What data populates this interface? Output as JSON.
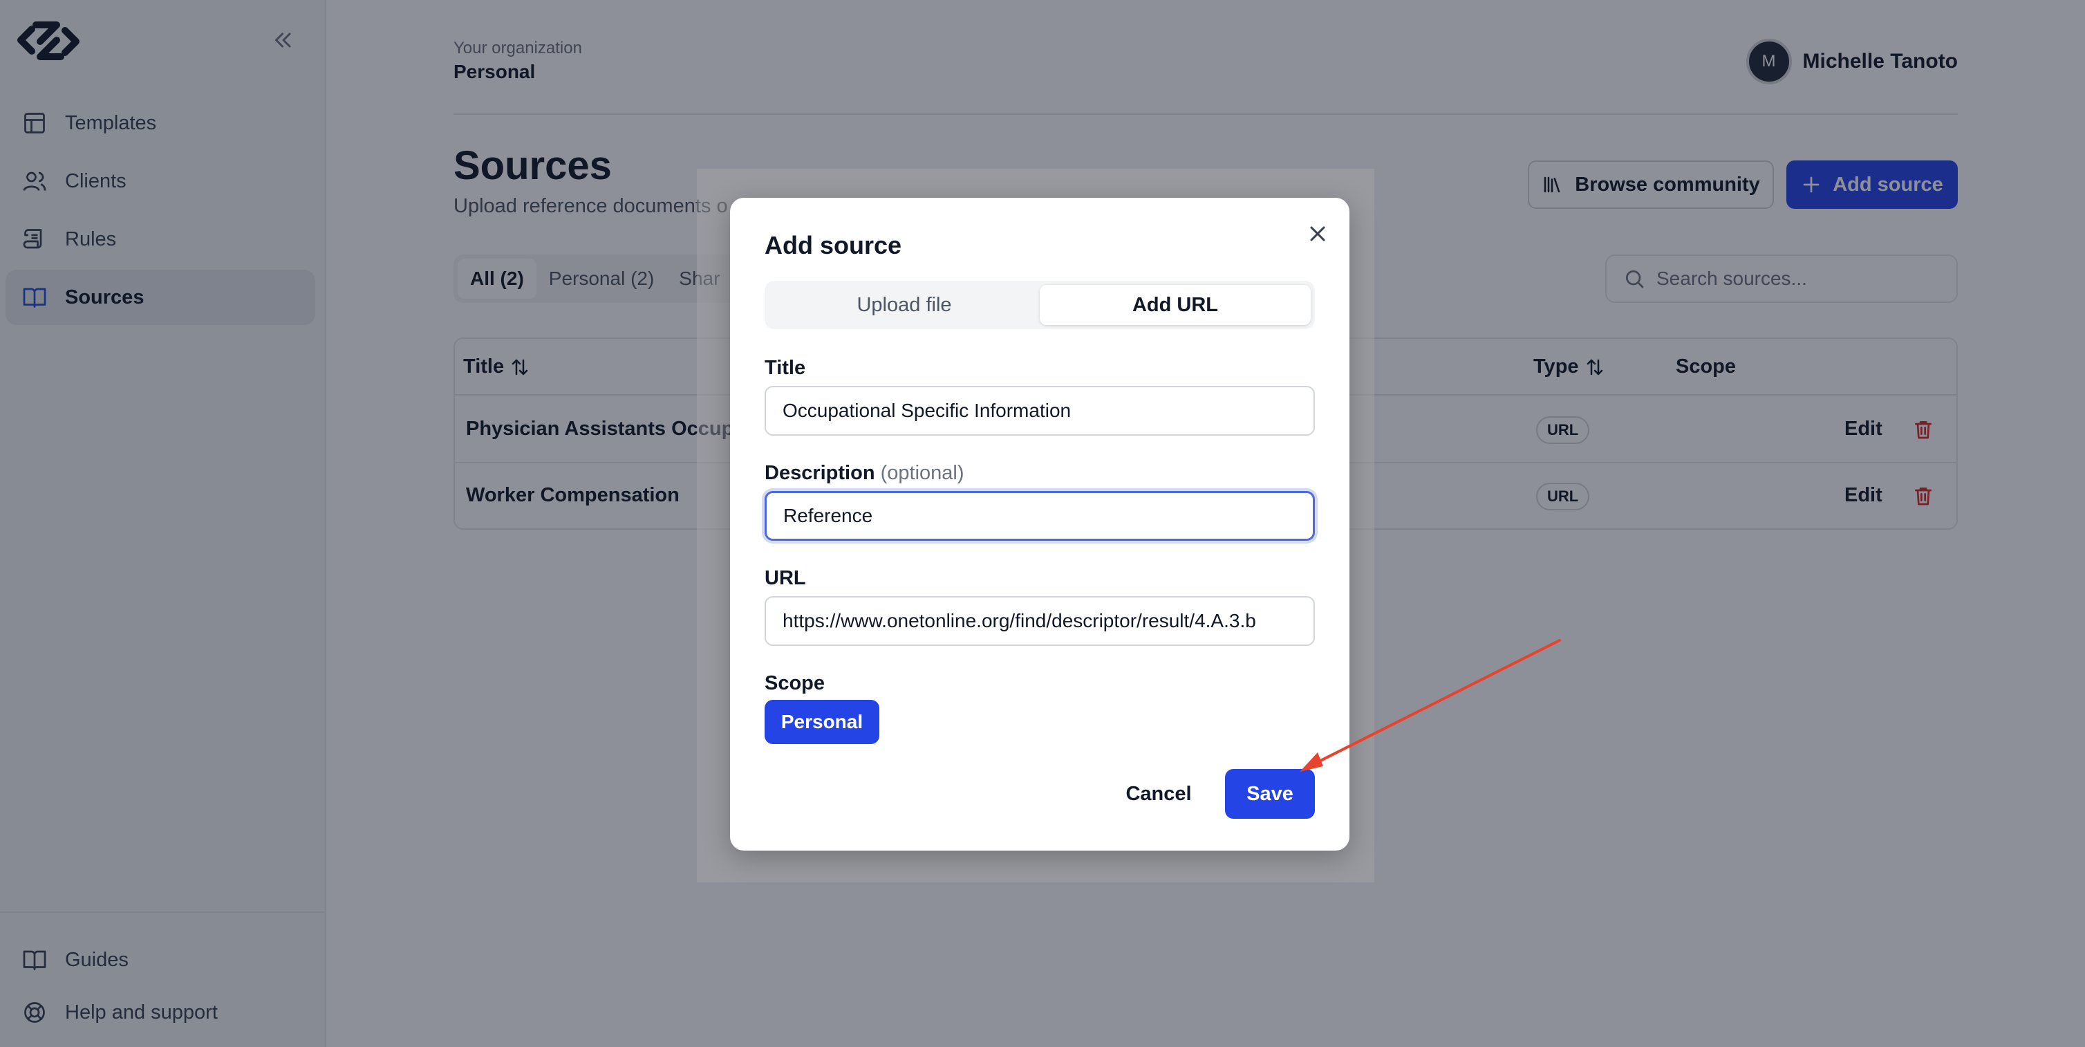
{
  "sidebar": {
    "items": [
      {
        "label": "Templates",
        "icon": "layout-icon"
      },
      {
        "label": "Clients",
        "icon": "users-icon"
      },
      {
        "label": "Rules",
        "icon": "scroll-icon"
      },
      {
        "label": "Sources",
        "icon": "book-icon"
      }
    ],
    "footer": [
      {
        "label": "Guides",
        "icon": "book-icon"
      },
      {
        "label": "Help and support",
        "icon": "lifebuoy-icon"
      }
    ]
  },
  "header": {
    "org_label": "Your organization",
    "org_name": "Personal",
    "user_initial": "M",
    "user_name": "Michelle Tanoto"
  },
  "page": {
    "title": "Sources",
    "subtitle": "Upload reference documents o",
    "browse_label": "Browse community",
    "add_label": "Add source",
    "tabs": [
      "All (2)",
      "Personal (2)",
      "Shar"
    ],
    "search_placeholder": "Search sources..."
  },
  "table": {
    "headers": {
      "title": "Title",
      "type": "Type",
      "scope": "Scope"
    },
    "rows": [
      {
        "title": "Physician Assistants Occupa",
        "type": "URL",
        "edit": "Edit"
      },
      {
        "title": "Worker Compensation",
        "type": "URL",
        "edit": "Edit"
      }
    ]
  },
  "modal": {
    "title": "Add source",
    "tabs": [
      "Upload file",
      "Add URL"
    ],
    "title_label": "Title",
    "title_value": "Occupational Specific Information",
    "desc_label": "Description",
    "desc_optional": "(optional)",
    "desc_value": "Reference",
    "url_label": "URL",
    "url_value": "https://www.onetonline.org/find/descriptor/result/4.A.3.b",
    "scope_label": "Scope",
    "scope_value": "Personal",
    "cancel_label": "Cancel",
    "save_label": "Save"
  },
  "colors": {
    "accent": "#2544e6",
    "danger": "#dc2626",
    "annotation": "#e8432d"
  }
}
